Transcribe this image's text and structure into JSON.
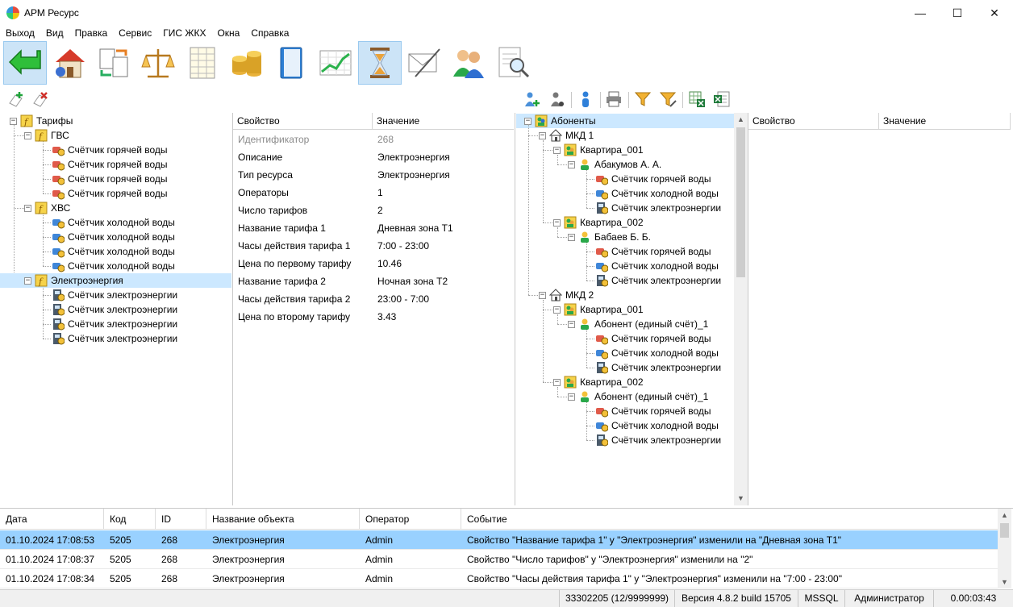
{
  "window": {
    "title": "АРМ Ресурс"
  },
  "menu": [
    "Выход",
    "Вид",
    "Правка",
    "Сервис",
    "ГИС ЖКХ",
    "Окна",
    "Справка"
  ],
  "toolbar": {
    "icons": [
      "back-arrow-icon",
      "house-icon",
      "exchange-docs-icon",
      "scales-icon",
      "spreadsheet-icon",
      "coins-icon",
      "book-icon",
      "chart-icon",
      "hourglass-icon",
      "envelope-pen-icon",
      "users-icon",
      "magnifier-document-icon"
    ],
    "active": "hourglass-icon"
  },
  "tariffs_tree": {
    "root": "Тарифы",
    "groups": [
      {
        "label": "ГВС",
        "meter": "Счётчик горячей воды",
        "count": 4
      },
      {
        "label": "ХВС",
        "meter": "Счётчик холодной воды",
        "count": 4
      },
      {
        "label": "Электроэнергия",
        "meter": "Счётчик электроэнергии",
        "count": 4
      }
    ],
    "selected": "Электроэнергия"
  },
  "properties": {
    "col_property": "Свойство",
    "col_value": "Значение",
    "rows": [
      {
        "name": "Идентификатор",
        "value": "268"
      },
      {
        "name": "Описание",
        "value": "Электроэнергия"
      },
      {
        "name": "Тип ресурса",
        "value": "Электроэнергия"
      },
      {
        "name": "Операторы",
        "value": "1"
      },
      {
        "name": "Число тарифов",
        "value": "2"
      },
      {
        "name": "Название тарифа 1",
        "value": "Дневная зона Т1"
      },
      {
        "name": "Часы действия тарифа 1",
        "value": "7:00 - 23:00"
      },
      {
        "name": "Цена по первому тарифу",
        "value": "10.46"
      },
      {
        "name": "Название тарифа 2",
        "value": "Ночная зона Т2"
      },
      {
        "name": "Часы действия тарифа 2",
        "value": "23:00 - 7:00"
      },
      {
        "name": "Цена по второму тарифу",
        "value": "3.43"
      }
    ]
  },
  "subscribers_tree": {
    "root": "Абоненты",
    "buildings": [
      {
        "label": "МКД 1",
        "apartments": [
          {
            "label": "Квартира_001",
            "owner": "Абакумов А. А.",
            "meters": [
              "Счётчик горячей воды",
              "Счётчик холодной воды",
              "Счётчик электроэнергии"
            ]
          },
          {
            "label": "Квартира_002",
            "owner": "Бабаев Б. Б.",
            "meters": [
              "Счётчик горячей воды",
              "Счётчик холодной воды",
              "Счётчик электроэнергии"
            ]
          }
        ]
      },
      {
        "label": "МКД 2",
        "apartments": [
          {
            "label": "Квартира_001",
            "owner": "Абонент (единый счёт)_1",
            "meters": [
              "Счётчик горячей воды",
              "Счётчик холодной воды",
              "Счётчик электроэнергии"
            ]
          },
          {
            "label": "Квартира_002",
            "owner": "Абонент (единый счёт)_1",
            "meters": [
              "Счётчик горячей воды",
              "Счётчик холодной воды",
              "Счётчик электроэнергии"
            ]
          }
        ]
      }
    ]
  },
  "right_properties": {
    "col_property": "Свойство",
    "col_value": "Значение"
  },
  "log": {
    "columns": [
      "Дата",
      "Код",
      "ID",
      "Название объекта",
      "Оператор",
      "Событие"
    ],
    "rows": [
      [
        "01.10.2024 17:08:53",
        "5205",
        "268",
        "Электроэнергия",
        "Admin",
        "Свойство \"Название тарифа 1\" у \"Электроэнергия\" изменили на \"Дневная зона Т1\""
      ],
      [
        "01.10.2024 17:08:37",
        "5205",
        "268",
        "Электроэнергия",
        "Admin",
        "Свойство \"Число тарифов\" у \"Электроэнергия\" изменили на \"2\""
      ],
      [
        "01.10.2024 17:08:34",
        "5205",
        "268",
        "Электроэнергия",
        "Admin",
        "Свойство \"Часы действия тарифа 1\" у \"Электроэнергия\" изменили на \"7:00 - 23:00\""
      ]
    ],
    "selected_row": 0
  },
  "status": {
    "license": "33302205 (12/9999999)",
    "version": "Версия 4.8.2 build 15705",
    "db": "MSSQL",
    "user": "Администратор",
    "timer": "0.00:03:43"
  },
  "colors": {
    "selection": "#cce8ff",
    "log_selection": "#99d1ff",
    "active_button": "#cce4f7"
  }
}
